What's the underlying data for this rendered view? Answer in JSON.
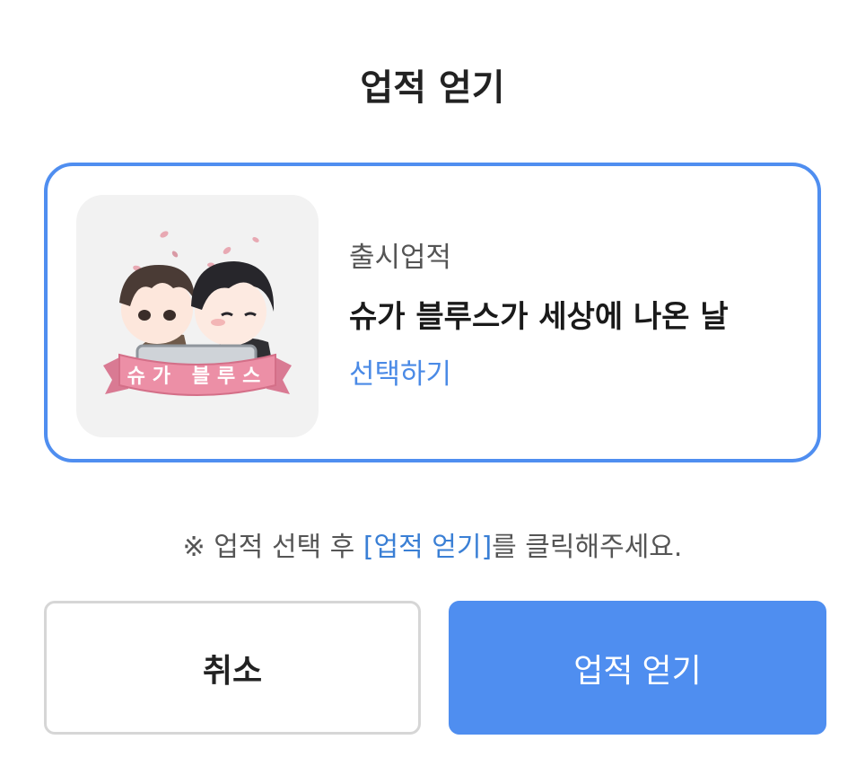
{
  "dialog": {
    "title": "업적 얻기"
  },
  "achievement": {
    "category": "출시업적",
    "title": "슈가 블루스가 세상에 나온 날",
    "select_label": "선택하기",
    "image_ribbon_text": "슈가 블루스"
  },
  "notice": {
    "prefix": "※ 업적 선택 후 ",
    "highlight": "[업적 얻기]",
    "suffix": "를 클릭해주세요."
  },
  "buttons": {
    "cancel_label": "취소",
    "confirm_label": "업적 얻기"
  },
  "colors": {
    "accent": "#4f8ef0",
    "link": "#4a8ae6",
    "ribbon": "#ec8fa6"
  }
}
